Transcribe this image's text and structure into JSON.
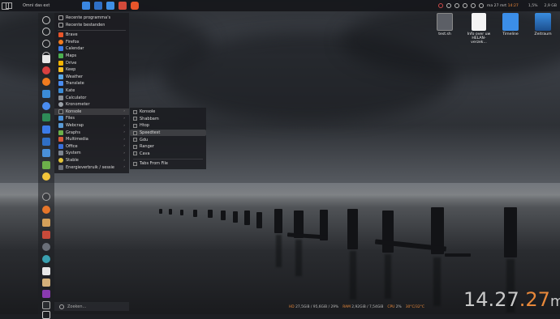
{
  "topbar": {
    "window_title": "Omni das ext",
    "tray_date": "ma 27 mrt",
    "tray_time": "14:27",
    "cpu_text": "1,5%",
    "mem_text": "2,9 GB"
  },
  "desktop_icons": [
    {
      "label": "test.sh",
      "icon": "script-file-icon"
    },
    {
      "label": "Info over uw HELAN-verzek...",
      "icon": "document-icon"
    },
    {
      "label": "Timeline",
      "icon": "folder-icon"
    },
    {
      "label": "Zeitraum",
      "icon": "image-icon"
    }
  ],
  "menu": {
    "top_items": [
      "Recente programma's",
      "Recente bestanden"
    ],
    "items": [
      {
        "label": "Brave",
        "color": "#e8552a"
      },
      {
        "label": "Firefox",
        "color": "#f07b1f"
      },
      {
        "label": "Calendar",
        "color": "#3b7be8"
      },
      {
        "label": "Maps",
        "color": "#4caf50"
      },
      {
        "label": "Drive",
        "color": "#f4b400"
      },
      {
        "label": "Keep",
        "color": "#f6c026"
      },
      {
        "label": "Weather",
        "color": "#58a6e6"
      },
      {
        "label": "Translate",
        "color": "#4a8cf0"
      },
      {
        "label": "Kate",
        "color": "#3b8bd6"
      },
      {
        "label": "Calculator",
        "color": "#8a8f96"
      },
      {
        "label": "Kronometer",
        "color": "#9aa1a8"
      },
      {
        "label": "Konsole",
        "color": "#2d2f33",
        "submenu": true
      },
      {
        "label": "Files",
        "color": "#4a90d9",
        "submenu": true
      },
      {
        "label": "Webcrap",
        "color": "#5a9bd5",
        "submenu": true
      },
      {
        "label": "Graphs",
        "color": "#6cb04a",
        "submenu": true
      },
      {
        "label": "Multimedia",
        "color": "#d95a3a",
        "submenu": true
      },
      {
        "label": "Office",
        "color": "#3a6fd9",
        "submenu": true
      },
      {
        "label": "System",
        "color": "#7d8590",
        "submenu": true
      },
      {
        "label": "Stable",
        "color": "#e3c43a",
        "submenu": true
      },
      {
        "label": "Energieverbruik / sessie",
        "color": "#6a6f78",
        "submenu": true
      }
    ],
    "search_placeholder": "Zoeken..."
  },
  "submenu": {
    "items": [
      "Konsole",
      "Shabbam",
      "Htop",
      "Speedtest",
      "Gdu",
      "Ranger",
      "Cava"
    ],
    "highlighted": "Speedtest",
    "extra": "Tabs From File"
  },
  "status": {
    "hd_label": "HD",
    "hd_value": "27,5GiB / 95,6GiB / 29%",
    "ram_label": "RAM",
    "ram_value": "2,92GiB / 7,54GiB",
    "cpu_label": "CPU",
    "cpu_value": "2%",
    "temp_value": "30°C/32°C"
  },
  "clock": {
    "hour": "14",
    "sep": ".",
    "minute": "27",
    "dot2": ".",
    "dup": "27",
    "day": "ma"
  }
}
